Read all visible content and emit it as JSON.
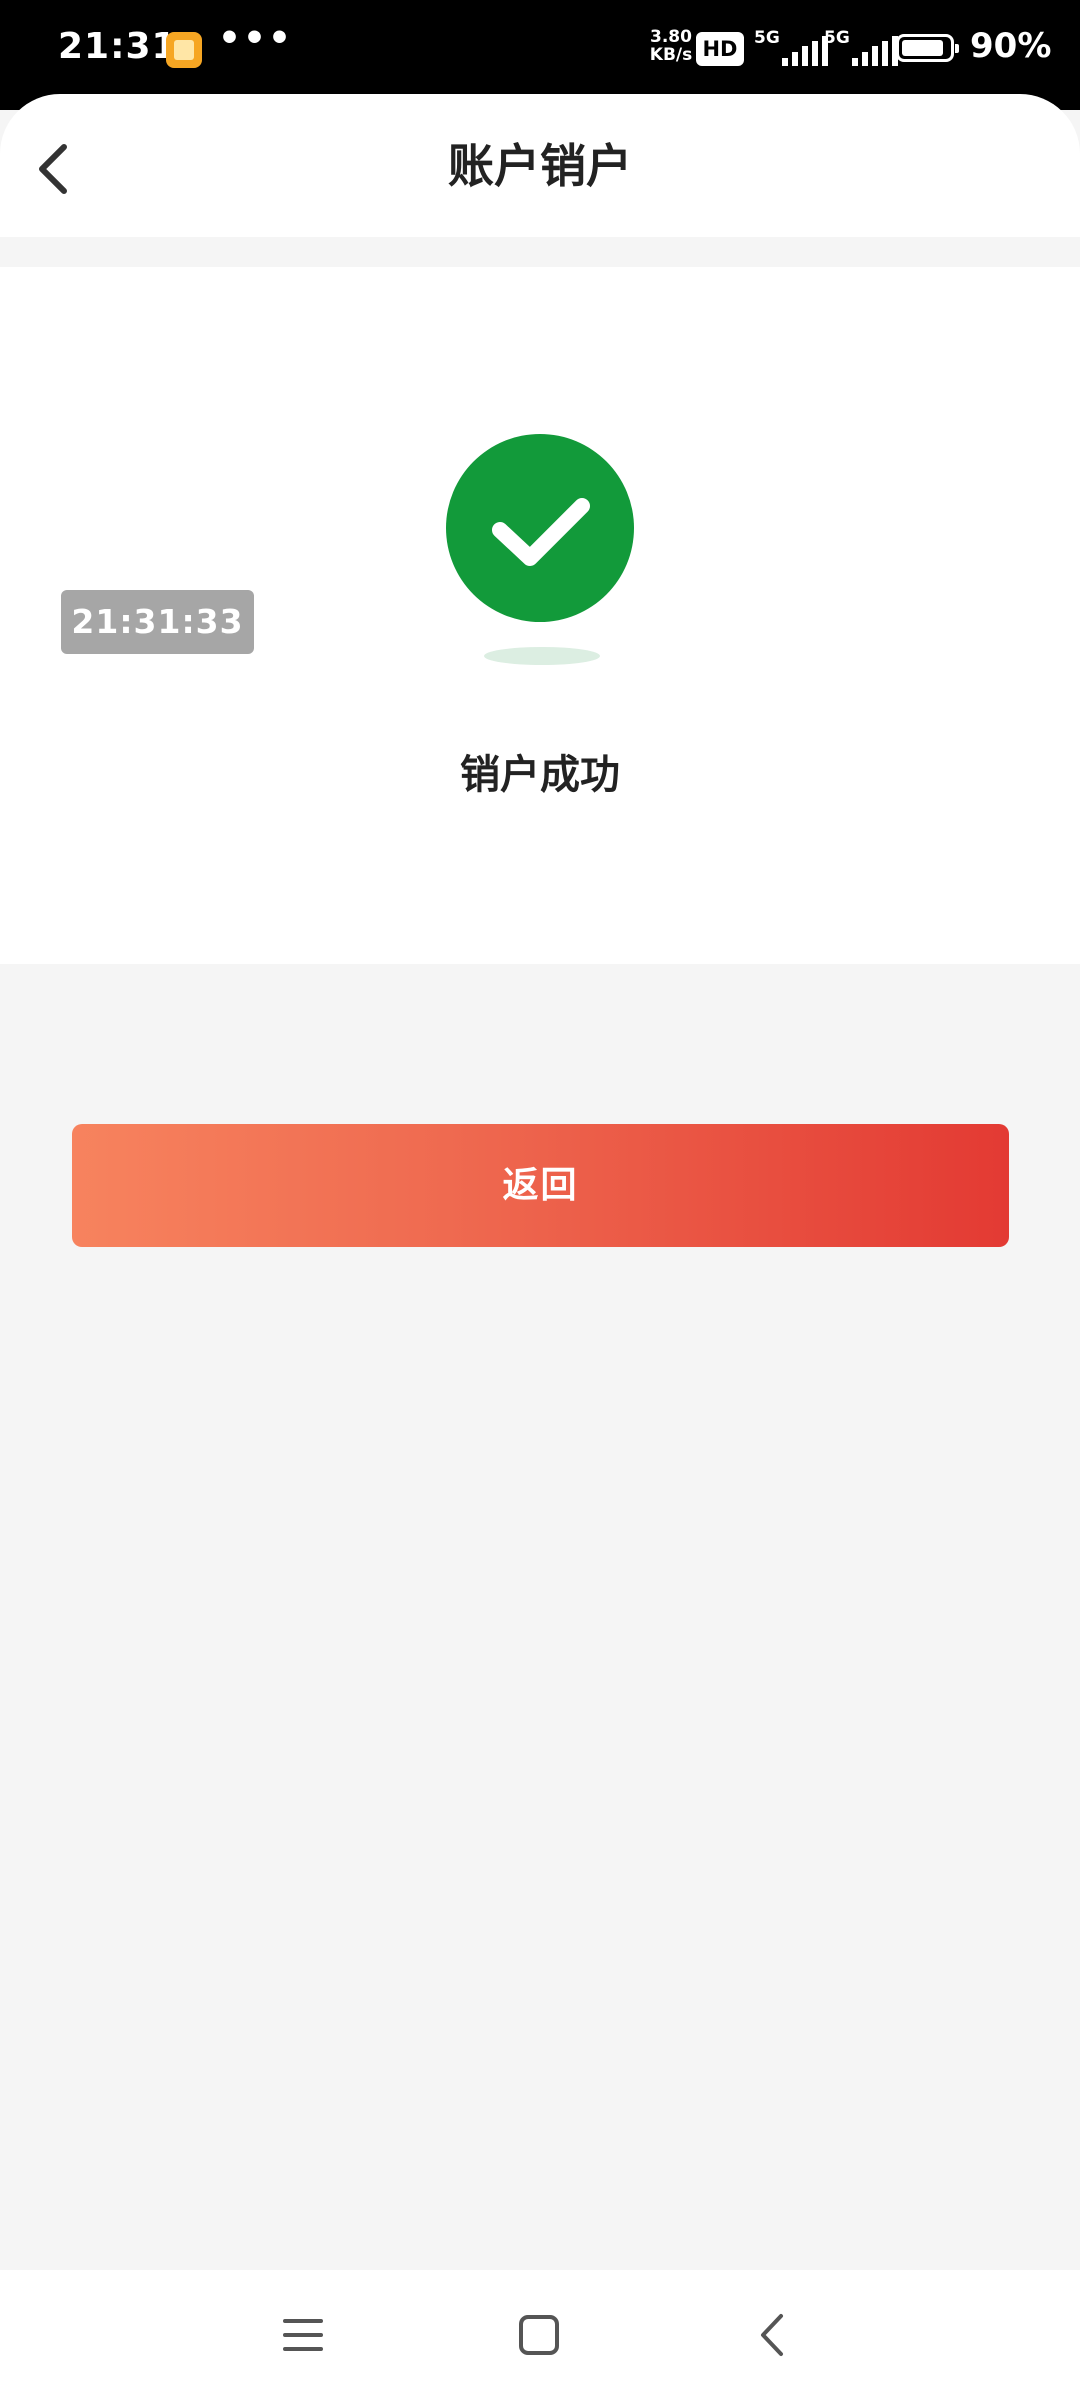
{
  "status_bar": {
    "time": "21:31",
    "more": "•••",
    "net_speed_value": "3.80",
    "net_speed_unit": "KB/s",
    "hd_badge": "HD",
    "sim1_label": "5G",
    "sim2_label": "5G",
    "battery_level": 0.9,
    "battery_text": "90%"
  },
  "header": {
    "title": "账户销户"
  },
  "result": {
    "timestamp": "21:31:33",
    "message": "销户成功",
    "accent_color": "#129a3a"
  },
  "actions": {
    "return_label": "返回"
  },
  "nav": {
    "menu_icon": "menu-icon",
    "home_icon": "home-icon",
    "back_icon": "back-icon"
  }
}
